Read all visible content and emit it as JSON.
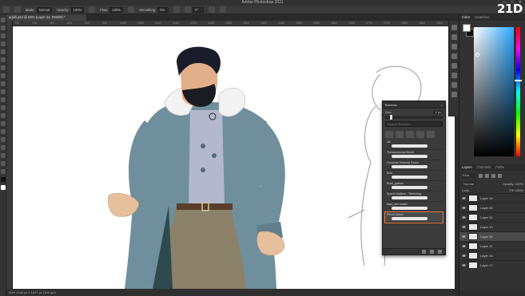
{
  "window": {
    "title": "Adobe Photoshop 2021",
    "controls": [
      "—",
      "□",
      "✕"
    ]
  },
  "options": {
    "mode_label": "Mode:",
    "mode_value": "Normal",
    "opacity_label": "Opacity:",
    "opacity_value": "100%",
    "flow_label": "Flow:",
    "flow_value": "100%",
    "smoothing_label": "Smoothing:",
    "smoothing_value": "0%",
    "angle_value": "0°"
  },
  "document": {
    "tab_label": "adalli.psd @ 50% (Layer 34, RGB/8) *",
    "status": "50%     2048 px x 1827 px (300 ppi)"
  },
  "ruler": {
    "ticks": [
      "700",
      "750",
      "800",
      "850",
      "900",
      "950",
      "1000",
      "1050",
      "1100",
      "1150",
      "1200",
      "1250",
      "1300",
      "1350",
      "1400",
      "1450",
      "1500",
      "1550",
      "1600",
      "1650",
      "1700",
      "1750",
      "1800",
      "1850",
      "1900"
    ]
  },
  "brushes_panel": {
    "title": "Brushes",
    "size_label": "Size",
    "size_value": "4 px",
    "search_placeholder": "Search Brushes",
    "items": [
      "Ink",
      "Thesamescript Brush",
      "Gouache Textured Brush",
      "Bulk",
      "Brick_grainer",
      "Sports Watkins - Sketching",
      "flack_lani shatel",
      "Pencil sketch"
    ]
  },
  "color_panel": {
    "tabs": [
      "Color",
      "Swatches"
    ]
  },
  "layers_panel": {
    "tabs": [
      "Layers",
      "Channels",
      "Paths"
    ],
    "kind_label": "Kind",
    "blend_mode": "Normal",
    "opacity_label": "Opacity: 100%",
    "lock_label": "Lock:",
    "fill_label": "Fill: 100%",
    "rows": [
      "Layer 14",
      "Layer 33",
      "Layer 32",
      "Layer 13",
      "Layer 34",
      "Layer 11",
      "Layer 16",
      "Layer 17"
    ],
    "selected_index": 4
  },
  "watermark": "21D"
}
